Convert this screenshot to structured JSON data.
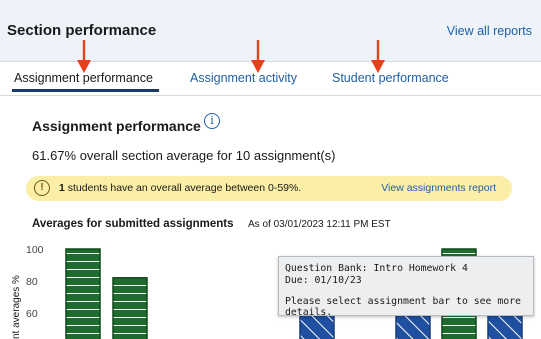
{
  "header": {
    "title": "Section performance",
    "view_all": "View all reports"
  },
  "tabs": [
    {
      "label": "Assignment performance"
    },
    {
      "label": "Assignment activity"
    },
    {
      "label": "Student performance"
    }
  ],
  "section": {
    "heading": "Assignment performance",
    "info_icon_glyph": "i",
    "summary": "61.67% overall section average for 10 assignment(s)"
  },
  "alert": {
    "icon_glyph": "!",
    "count": "1",
    "message": " students have an overall average between 0-59%.",
    "link": "View assignments report"
  },
  "chart_heading": {
    "title": "Averages for submitted assignments",
    "as_of": "As of 03/01/2023 12:11 PM EST"
  },
  "chart_data": {
    "type": "bar",
    "ylabel": "nt averages %",
    "yticks": [
      "100",
      "80",
      "60"
    ],
    "ylim": [
      50,
      100
    ],
    "bars": [
      {
        "value": 100,
        "style": "solid-green"
      },
      {
        "value": 82,
        "style": "solid-green"
      },
      {
        "value": 60,
        "style": "hatched-blue"
      },
      {
        "value": 60,
        "style": "hatched-blue"
      },
      {
        "value": 100,
        "style": "solid-green"
      },
      {
        "value": 60,
        "style": "hatched-blue"
      }
    ]
  },
  "tooltip": {
    "line1": "Question Bank: Intro Homework 4",
    "line2": "Due: 01/10/23",
    "line3": "Please select assignment bar to see more details."
  },
  "colors": {
    "link": "#1f5fa8",
    "arrow": "#e8401c",
    "bar_green": "#1e6b2e",
    "bar_blue": "#1f4f9e",
    "alert_bg": "#fbeea6"
  }
}
